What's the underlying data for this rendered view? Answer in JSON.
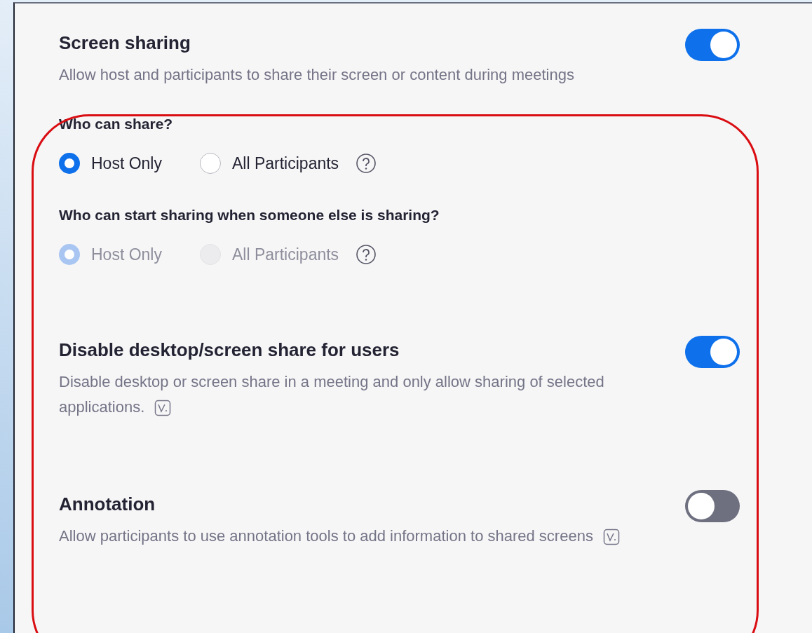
{
  "settings": [
    {
      "title": "Screen sharing",
      "description": "Allow host and participants to share their screen or content during meetings",
      "on": true,
      "questions": [
        {
          "label": "Who can share?",
          "disabled": false,
          "options": [
            {
              "label": "Host Only",
              "selected": true
            },
            {
              "label": "All Participants",
              "selected": false
            }
          ]
        },
        {
          "label": "Who can start sharing when someone else is sharing?",
          "disabled": true,
          "options": [
            {
              "label": "Host Only",
              "selected": true
            },
            {
              "label": "All Participants",
              "selected": false
            }
          ]
        }
      ]
    },
    {
      "title": "Disable desktop/screen share for users",
      "description": "Disable desktop or screen share in a meeting and only allow sharing of selected applications.",
      "version_icon": true,
      "on": true
    },
    {
      "title": "Annotation",
      "description": "Allow participants to use annotation tools to add information to shared screens",
      "version_icon": true,
      "on": false
    }
  ]
}
